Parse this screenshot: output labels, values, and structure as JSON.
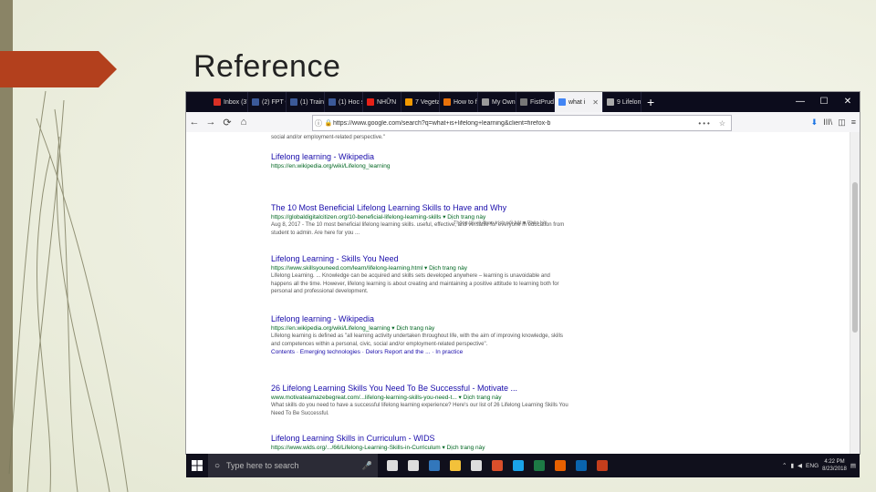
{
  "slide": {
    "title": "Reference"
  },
  "browser": {
    "tabs": [
      {
        "label": "Inbox (375)",
        "icon": "gmail-icon",
        "color": "#d93025"
      },
      {
        "label": "(2) FPT Ob",
        "icon": "facebook-icon",
        "color": "#3b5998"
      },
      {
        "label": "(1) Trainin",
        "icon": "facebook-icon",
        "color": "#3b5998"
      },
      {
        "label": "(1) Hoc sit",
        "icon": "facebook-icon",
        "color": "#3b5998"
      },
      {
        "label": "NHỮN",
        "icon": "youtube-icon",
        "color": "#e62117"
      },
      {
        "label": "7 Vegetab",
        "icon": "bookmark-icon",
        "color": "#f29900"
      },
      {
        "label": "How to fin",
        "icon": "bookmark-icon",
        "color": "#e8710a"
      },
      {
        "label": "My Own F",
        "icon": "page-icon",
        "color": "#999999"
      },
      {
        "label": "FistPrudingAp",
        "icon": "page-icon",
        "color": "#777777"
      },
      {
        "label": "what i",
        "icon": "google-icon",
        "color": "#4285f4",
        "active": true
      },
      {
        "label": "9 Lifelong",
        "icon": "page-icon",
        "color": "#aaaaaa"
      }
    ],
    "new_tab": "+",
    "window_controls": {
      "minimize": "—",
      "maximize": "☐",
      "close": "✕"
    },
    "nav": {
      "back": "←",
      "forward": "→",
      "reload": "⟳",
      "home": "⌂"
    },
    "url": "https://www.google.com/search?q=what+is+lifelong+learning&client=firefox-b",
    "url_dots": "•••",
    "toolbar_right": {
      "download": "⬇",
      "library": "III\\",
      "sidebar": "◫",
      "menu": "≡"
    }
  },
  "results": {
    "top_snippet": "social and/or employment-related perspective.\"",
    "wiki_top": {
      "title": "Lifelong learning - Wikipedia",
      "url": "https://en.wikipedia.org/wiki/Lifelong_learning"
    },
    "feedback": "Thông tin về đoạn trích nổi bật   ■ Phản hồi",
    "items": [
      {
        "title": "The 10 Most Beneficial Lifelong Learning Skills to Have and Why",
        "url": "https://globaldigitalcitizen.org/10-beneficial-lifelong-learning-skills ▾ Dịch trang này",
        "snippet": "Aug 8, 2017 - The 10 most beneficial lifelong learning skills. useful, effective, and versatile for everyone in education from student to admin. Are here for you ..."
      },
      {
        "title": "Lifelong Learning - Skills You Need",
        "url": "https://www.skillsyouneed.com/learn/lifelong-learning.html ▾ Dịch trang này",
        "snippet": "Lifelong Learning. ... Knowledge can be acquired and skills sets developed anywhere – learning is unavoidable and happens all the time. However, lifelong learning is about creating and maintaining a positive attitude to learning both for personal and professional development."
      },
      {
        "title": "Lifelong learning - Wikipedia",
        "url": "https://en.wikipedia.org/wiki/Lifelong_learning ▾ Dịch trang này",
        "snippet": "Lifelong learning is defined as \"all learning activity undertaken throughout life, with the aim of improving knowledge, skills and competences within a personal, civic, social and/or employment-related perspective\".",
        "sitelinks": "Contents · Emerging technologies · Delors Report and the ... · In practice"
      },
      {
        "title": "26 Lifelong Learning Skills You Need To Be Successful - Motivate ...",
        "url": "www.motivateamazebegreat.com/...lifelong-learning-skills-you-need-t... ▾ Dịch trang này",
        "snippet": "What skills do you need to have a successful lifelong learning experience? Here's our list of 26 Lifelong Learning Skills You Need To Be Successful."
      },
      {
        "title": "Lifelong Learning Skills in Curriculum - WIDS",
        "url": "https://www.wids.org/.../66/Lifelong-Learning-Skills-in-Curriculum ▾ Dịch trang này",
        "snippet": ""
      }
    ]
  },
  "taskbar": {
    "search_placeholder": "Type here to search",
    "apps": [
      {
        "icon": "task-view-icon",
        "color": "#dddddd"
      },
      {
        "icon": "store-icon",
        "color": "#dddddd"
      },
      {
        "icon": "edge-icon",
        "color": "#3277bc"
      },
      {
        "icon": "folder-icon",
        "color": "#f3c13a"
      },
      {
        "icon": "store-bag-icon",
        "color": "#dddddd"
      },
      {
        "icon": "app-icon",
        "color": "#d94f2b"
      },
      {
        "icon": "skype-icon",
        "color": "#1aa3e8"
      },
      {
        "icon": "excel-icon",
        "color": "#1d7a45"
      },
      {
        "icon": "firefox-icon",
        "color": "#e66000"
      },
      {
        "icon": "outlook-icon",
        "color": "#0a64ad"
      },
      {
        "icon": "powerpoint-icon",
        "color": "#c43e1c"
      }
    ],
    "tray": {
      "lang": "ENG",
      "time": "4:22 PM",
      "date": "8/23/2018"
    }
  }
}
